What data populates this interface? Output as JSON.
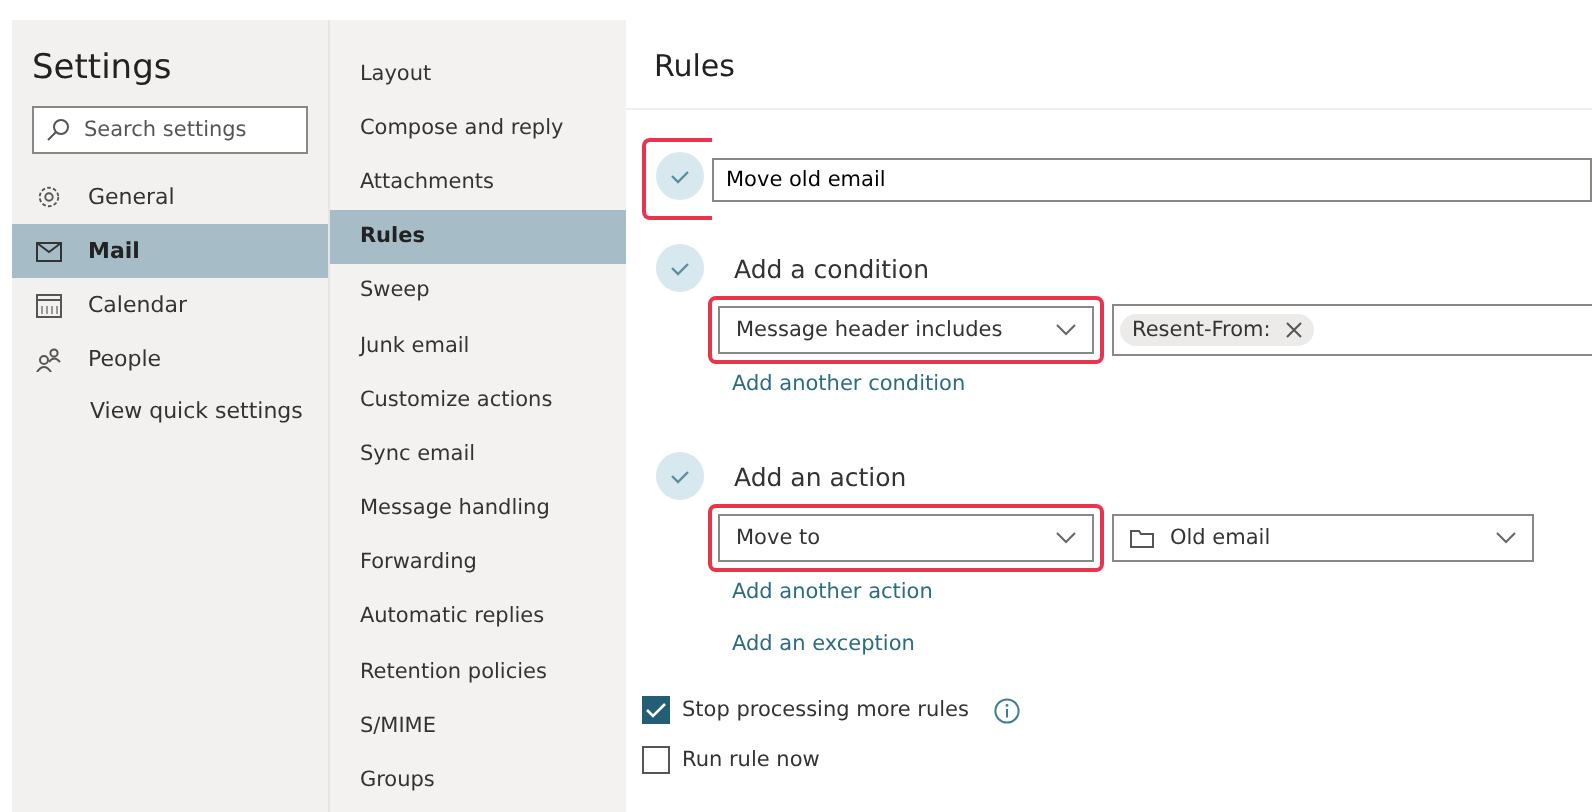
{
  "sidebar": {
    "title": "Settings",
    "search": {
      "placeholder": "Search settings"
    },
    "items": [
      {
        "label": "General",
        "selected": false
      },
      {
        "label": "Mail",
        "selected": true
      },
      {
        "label": "Calendar",
        "selected": false
      },
      {
        "label": "People",
        "selected": false
      }
    ],
    "link": "View quick settings"
  },
  "subnav": {
    "items": [
      {
        "label": "Layout",
        "selected": false
      },
      {
        "label": "Compose and reply",
        "selected": false
      },
      {
        "label": "Attachments",
        "selected": false
      },
      {
        "label": "Rules",
        "selected": true
      },
      {
        "label": "Sweep",
        "selected": false
      },
      {
        "label": "Junk email",
        "selected": false
      },
      {
        "label": "Customize actions",
        "selected": false
      },
      {
        "label": "Sync email",
        "selected": false
      },
      {
        "label": "Message handling",
        "selected": false
      },
      {
        "label": "Forwarding",
        "selected": false
      },
      {
        "label": "Automatic replies",
        "selected": false
      },
      {
        "label": "Retention policies",
        "selected": false
      },
      {
        "label": "S/MIME",
        "selected": false
      },
      {
        "label": "Groups",
        "selected": false
      }
    ]
  },
  "rules": {
    "title": "Rules",
    "name_field": {
      "value": "Move old email",
      "highlighted": true
    },
    "condition": {
      "heading": "Add a condition",
      "dropdown": {
        "value": "Message header includes",
        "highlighted": true
      },
      "chip": "Resent-From:",
      "link": "Add another condition"
    },
    "action": {
      "heading": "Add an action",
      "dropdown": {
        "value": "Move to",
        "highlighted": true
      },
      "folder": "Old email",
      "link": "Add another action"
    },
    "exception_link": "Add an exception",
    "options": [
      {
        "label": "Stop processing more rules",
        "checked": true,
        "info": true
      },
      {
        "label": "Run rule now",
        "checked": false,
        "info": false
      }
    ]
  }
}
